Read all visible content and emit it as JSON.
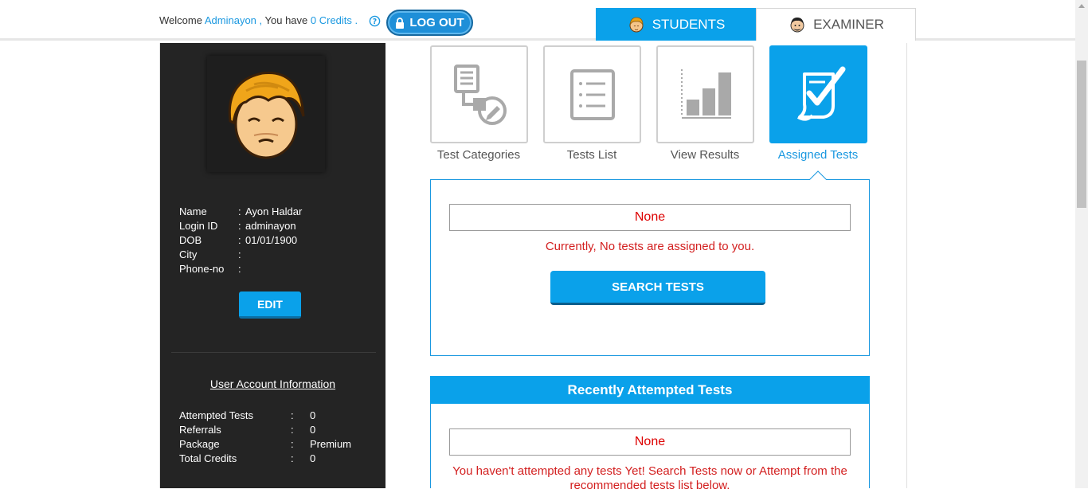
{
  "header": {
    "welcome_prefix": "Welcome",
    "username": "Adminayon ,",
    "credits_prefix": "You have",
    "credits": "0 Credits .",
    "logout_label": "LOG OUT",
    "role_tabs": [
      {
        "label": "STUDENTS",
        "icon": "student-avatar-icon",
        "active": true
      },
      {
        "label": "EXAMINER",
        "icon": "examiner-avatar-icon",
        "active": false
      }
    ]
  },
  "profile": {
    "fields": [
      {
        "key": "Name",
        "value": "Ayon Haldar"
      },
      {
        "key": "Login ID",
        "value": "adminayon"
      },
      {
        "key": "DOB",
        "value": "01/01/1900"
      },
      {
        "key": "City",
        "value": ""
      },
      {
        "key": "Phone-no",
        "value": ""
      }
    ],
    "edit_label": "EDIT"
  },
  "account": {
    "title": "User Account Information",
    "fields": [
      {
        "key": "Attempted Tests",
        "value": "0"
      },
      {
        "key": "Referrals",
        "value": "0"
      },
      {
        "key": "Package",
        "value": "Premium"
      },
      {
        "key": "Total Credits",
        "value": "0"
      }
    ]
  },
  "tiles": [
    {
      "label": "Test Categories",
      "icon": "test-categories-icon",
      "active": false
    },
    {
      "label": "Tests List",
      "icon": "tests-list-icon",
      "active": false
    },
    {
      "label": "View Results",
      "icon": "bar-chart-icon",
      "active": false
    },
    {
      "label": "Assigned Tests",
      "icon": "assigned-checklist-icon",
      "active": true
    }
  ],
  "assigned": {
    "none_label": "None",
    "message": "Currently, No tests are assigned to you.",
    "search_label": "SEARCH TESTS"
  },
  "recent": {
    "title": "Recently Attempted Tests",
    "none_label": "None",
    "message": "You haven't attempted any tests Yet! Search Tests now or Attempt from the recommended tests list below."
  },
  "colors": {
    "accent": "#0aa1ea",
    "sidebar": "#242424",
    "error": "#d32020"
  }
}
